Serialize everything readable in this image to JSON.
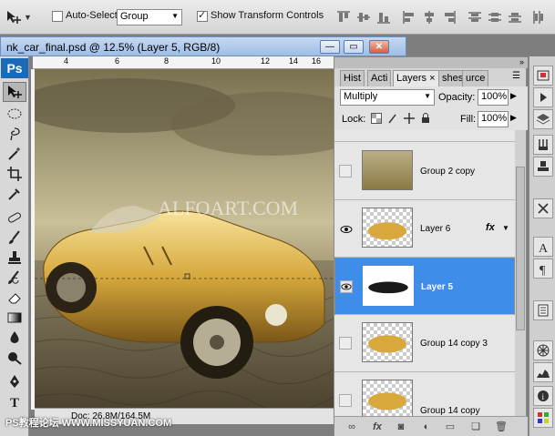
{
  "options_bar": {
    "auto_select_label": "Auto-Select:",
    "auto_select_checked": false,
    "auto_select_value": "Group",
    "show_transform_label": "Show Transform Controls",
    "show_transform_checked": true
  },
  "document": {
    "title": "nk_car_final.psd @ 12.5% (Layer 5, RGB/8)",
    "zoom": "12.5%",
    "ruler_ticks": [
      "4",
      "6",
      "8",
      "10",
      "12",
      "14",
      "16"
    ],
    "watermark": "ALFOART.COM",
    "status": "Doc: 26.8M/164.5M"
  },
  "tools": [
    "move-tool",
    "marquee-tool",
    "lasso-tool",
    "magic-wand-tool",
    "crop-tool",
    "eyedropper-tool",
    "healing-tool",
    "brush-tool",
    "stamp-tool",
    "history-brush-tool",
    "eraser-tool",
    "gradient-tool",
    "blur-tool",
    "dodge-tool",
    "pen-tool",
    "type-tool"
  ],
  "layers_panel": {
    "tabs": [
      "Hist",
      "Acti",
      "Layers",
      "shes",
      "urce"
    ],
    "active_tab": "Layers",
    "blend_mode": "Multiply",
    "opacity_label": "Opacity:",
    "opacity_value": "100%",
    "lock_label": "Lock:",
    "fill_label": "Fill:",
    "fill_value": "100%",
    "fx_label": "fx",
    "layers": [
      {
        "name": "Group 2 copy",
        "visible": false,
        "selected": false,
        "fx": false
      },
      {
        "name": "Layer 6",
        "visible": true,
        "selected": false,
        "fx": true
      },
      {
        "name": "Layer 5",
        "visible": true,
        "selected": true,
        "fx": false
      },
      {
        "name": "Group 14 copy 3",
        "visible": false,
        "selected": false,
        "fx": false
      },
      {
        "name": "Group 14 copy",
        "visible": false,
        "selected": false,
        "fx": false
      }
    ]
  },
  "footer_watermark": "PS教程论坛 WWW.MISSYUAN.COM",
  "colors": {
    "selection_blue": "#3d8de9",
    "titlebar_blue": "#9fbde6",
    "ps_logo": "#1a6ab8"
  }
}
